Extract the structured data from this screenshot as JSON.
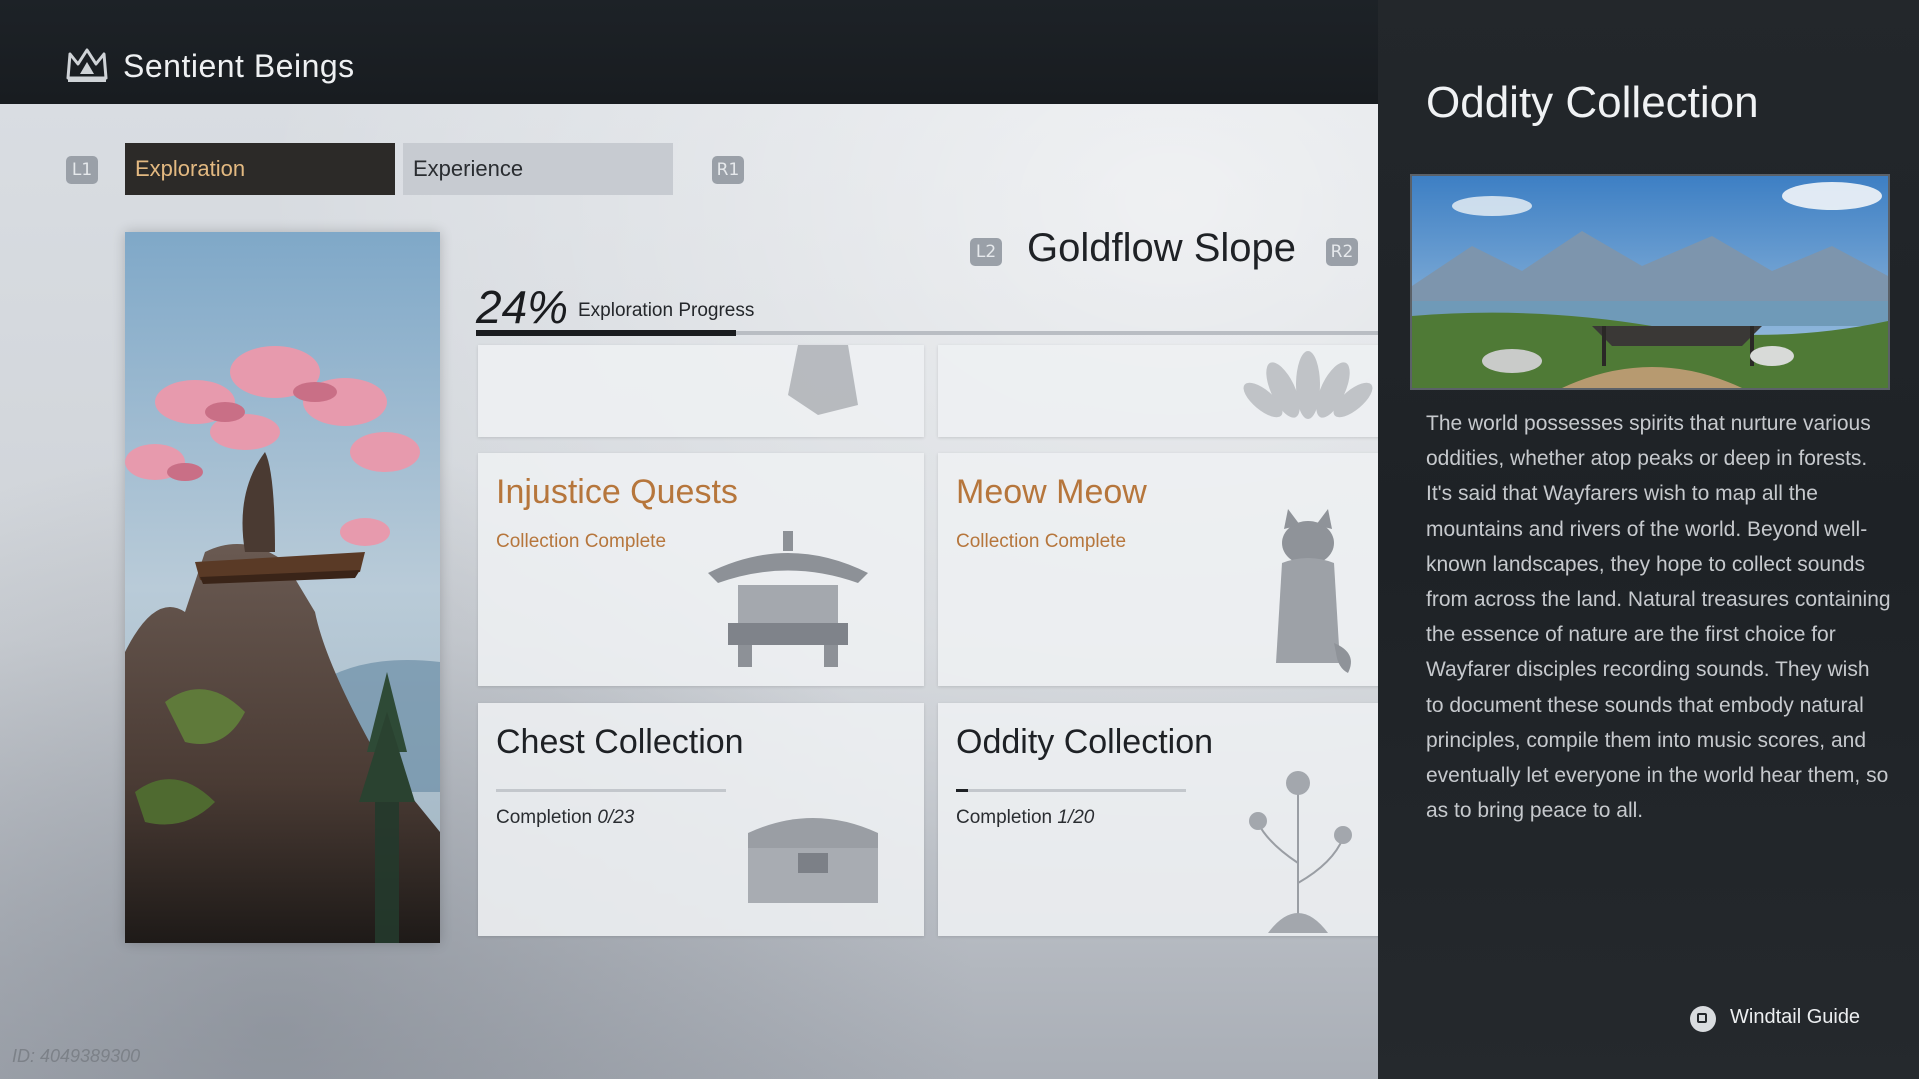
{
  "header": {
    "title": "Sentient Beings",
    "icon": "crown-icon"
  },
  "tabs": {
    "left_hint": "L1",
    "right_hint": "R1",
    "items": [
      {
        "label": "Exploration",
        "active": true
      },
      {
        "label": "Experience",
        "active": false
      }
    ]
  },
  "region": {
    "prev_hint": "L2",
    "next_hint": "R2",
    "name": "Goldflow Slope"
  },
  "progress": {
    "percent_text": "24%",
    "label": "Exploration Progress",
    "value": 0.24
  },
  "cards": [
    {
      "title": "Injustice Quests",
      "subtitle": "Collection Complete",
      "icon": "incense-burner-icon"
    },
    {
      "title": "Meow Meow",
      "subtitle": "Collection Complete",
      "icon": "cat-icon"
    },
    {
      "title": "Chest Collection",
      "progress_label": "Completion",
      "progress_value": "0/23",
      "fraction": 0
    },
    {
      "title": "Oddity Collection",
      "progress_label": "Completion",
      "progress_value": "1/20",
      "fraction": 0.05
    }
  ],
  "detail": {
    "title": "Oddity Collection",
    "description": "The world possesses spirits that nurture various oddities, whether atop peaks or deep in forests. It's said that Wayfarers wish to map all the mountains and rivers of the world. Beyond well-known landscapes, they hope to collect sounds from across the land. Natural treasures containing the essence of nature are the first choice for Wayfarer disciples recording sounds. They wish to document these sounds that embody natural principles, compile them into music scores, and eventually let everyone in the world hear them, so as to bring peace to all."
  },
  "guide": {
    "label": "Windtail Guide",
    "icon": "square-button-icon"
  },
  "id_tag": "ID: 4049389300",
  "colors": {
    "accent_gold": "#b6763c",
    "tab_active_text": "#e3b981"
  }
}
